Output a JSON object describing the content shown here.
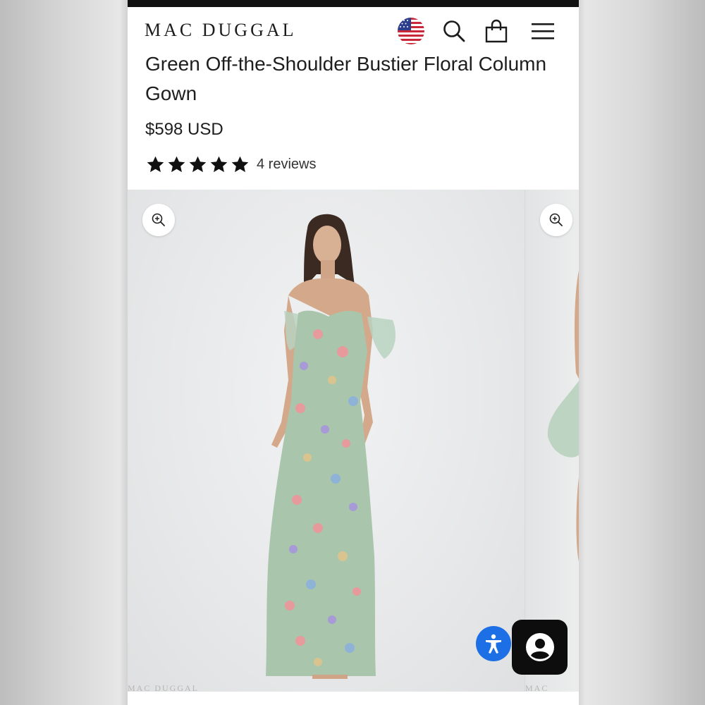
{
  "header": {
    "logo": "MAC DUGGAL",
    "flag_icon": "us-flag-icon",
    "search_icon": "search-icon",
    "cart_icon": "shopping-bag-icon",
    "menu_icon": "hamburger-menu-icon"
  },
  "product": {
    "title": "Green Off-the-Shoulder Bustier Floral Column Gown",
    "price": "$598 USD",
    "rating": {
      "stars": 5,
      "max": 5,
      "reviews_label": "4 reviews"
    }
  },
  "gallery": {
    "zoom_icon": "zoom-in-icon",
    "watermark": "MAC DUGGAL",
    "dress_colors": {
      "base": "#a9c6ad",
      "pink": "#e79a9c",
      "purple": "#a79ad6",
      "blue": "#8fb3d6",
      "gold": "#d9c48f"
    }
  },
  "widgets": {
    "accessibility_icon": "accessibility-icon",
    "accessibility_color": "#1d6fe6",
    "chat_icon": "user-account-icon",
    "chat_color": "#0d0d0d"
  }
}
